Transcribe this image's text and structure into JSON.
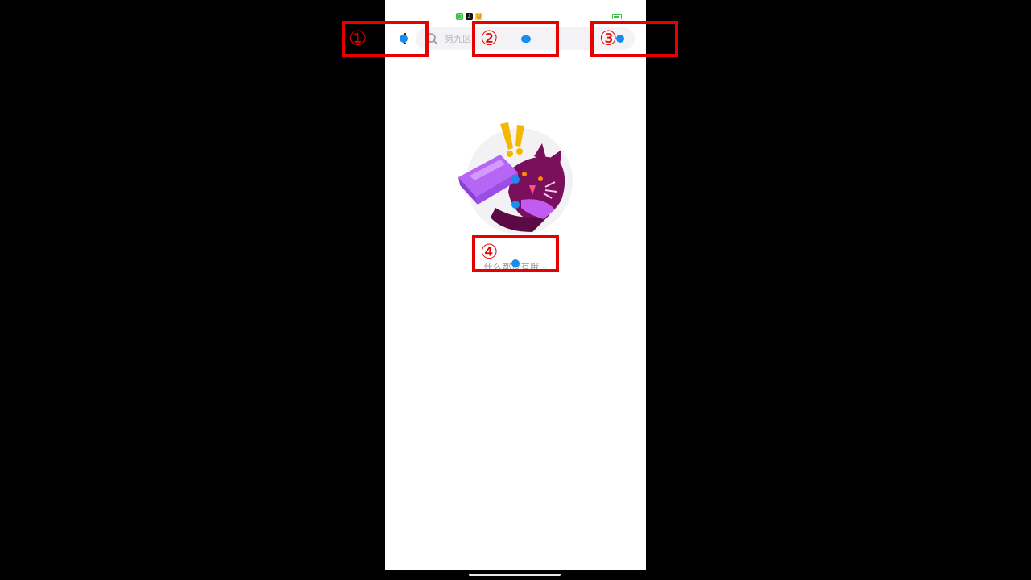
{
  "status_bar": {
    "icons": [
      "wechat-icon",
      "tiktok-icon",
      "emoji-app-icon"
    ],
    "battery_level": 0.85
  },
  "search": {
    "placeholder": "第九区"
  },
  "empty_state": {
    "message": "什么都没有哦~"
  },
  "annotations": {
    "markers": [
      {
        "label": "①",
        "target": "back-button"
      },
      {
        "label": "②",
        "target": "search-input"
      },
      {
        "label": "③",
        "target": "search-box-right"
      },
      {
        "label": "④",
        "target": "empty-message"
      }
    ],
    "color": "#e60000",
    "dot_color": "#1a8cf0"
  }
}
